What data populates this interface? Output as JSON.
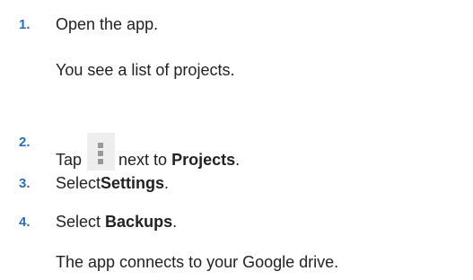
{
  "steps": [
    {
      "number": "1.",
      "text": "Open the app.",
      "result": "You see a list of projects."
    },
    {
      "number": "2.",
      "text_before": "Tap",
      "icon": "overflow-menu-icon",
      "text_middle": "next to",
      "bold": "Projects",
      "text_after": "."
    },
    {
      "number": "3.",
      "text": "Select",
      "bold": "Settings",
      "text_after": "."
    },
    {
      "number": "4.",
      "text": "Select",
      "bold": "Backups",
      "text_after": ".",
      "result": "The app connects to your Google drive."
    }
  ],
  "colors": {
    "step_number": "#2e6bb0",
    "text": "#222222",
    "icon_bg": "#eeeeee",
    "icon_dot": "#999999"
  }
}
